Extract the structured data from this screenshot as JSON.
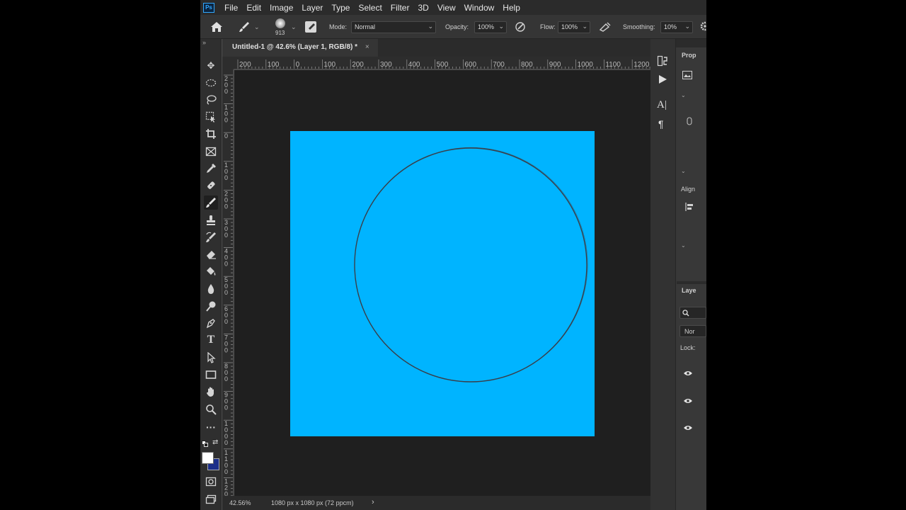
{
  "app": {
    "logo_text": "Ps"
  },
  "menu": [
    "File",
    "Edit",
    "Image",
    "Layer",
    "Type",
    "Select",
    "Filter",
    "3D",
    "View",
    "Window",
    "Help"
  ],
  "options": {
    "brush_size": "913",
    "mode_label": "Mode:",
    "mode_value": "Normal",
    "opacity_label": "Opacity:",
    "opacity_value": "100%",
    "flow_label": "Flow:",
    "flow_value": "100%",
    "smoothing_label": "Smoothing:",
    "smoothing_value": "10%"
  },
  "document": {
    "tab_title": "Untitled-1 @ 42.6% (Layer 1, RGB/8) *",
    "close_glyph": "×",
    "ruler_top_labels": [
      "200",
      "100",
      "0",
      "100",
      "200",
      "300",
      "400",
      "500",
      "600",
      "700",
      "800",
      "900",
      "1000",
      "1100",
      "1200"
    ],
    "ruler_left_labels": [
      "200",
      "100",
      "0",
      "100",
      "200",
      "300",
      "400",
      "500",
      "600",
      "700",
      "800",
      "900",
      "1000",
      "1100",
      "1200"
    ],
    "canvas_color": "#00b4ff",
    "circle_stroke_color": "#3a3f4a"
  },
  "status": {
    "zoom": "42.56%",
    "doc_info": "1080 px x 1080 px (72 ppcm)",
    "arrow": "›"
  },
  "colors": {
    "foreground": "#ffffff",
    "background": "#1c2f8a"
  },
  "panels": {
    "properties_title": "Prop",
    "align_label": "Align",
    "layers_title": "Laye",
    "blend_mode_partial": "Nor",
    "lock_label": "Lock:"
  }
}
